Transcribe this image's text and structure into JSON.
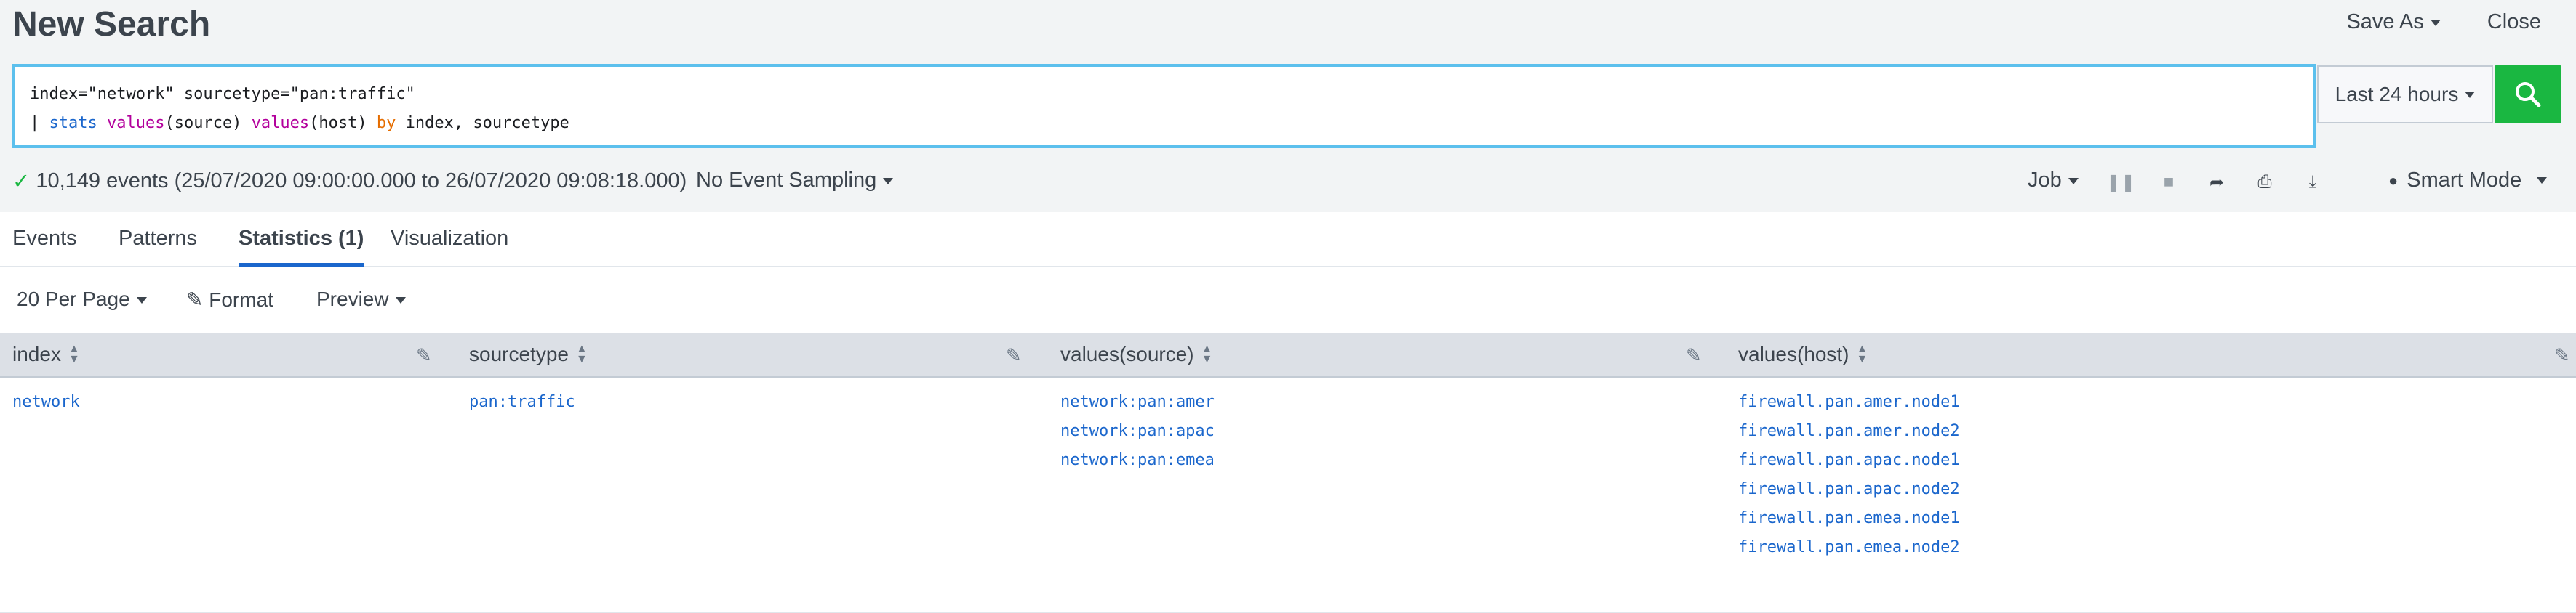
{
  "header": {
    "title": "New Search",
    "save_as": "Save As",
    "close": "Close"
  },
  "search": {
    "line1": "index=\"network\" sourcetype=\"pan:traffic\"",
    "line2": {
      "pipe": "| ",
      "cmd": "stats",
      "fn1": "values",
      "arg1": "(source) ",
      "fn2": "values",
      "arg2": "(host) ",
      "kw": "by",
      "rest": " index, sourcetype"
    },
    "time_range": "Last 24 hours"
  },
  "status": {
    "events": "10,149 events (25/07/2020 09:00:00.000 to 26/07/2020 09:08:18.000)",
    "sampling": "No Event Sampling",
    "job": "Job",
    "mode": "Smart Mode"
  },
  "tabs": [
    {
      "label": "Events"
    },
    {
      "label": "Patterns"
    },
    {
      "label": "Statistics (1)"
    },
    {
      "label": "Visualization"
    }
  ],
  "toolbar": {
    "per_page": "20 Per Page",
    "format": "Format",
    "preview": "Preview"
  },
  "table": {
    "columns": [
      "index",
      "sourcetype",
      "values(source)",
      "values(host)"
    ],
    "rows": [
      {
        "index": "network",
        "sourcetype": "pan:traffic",
        "sources": [
          "network:pan:amer",
          "network:pan:apac",
          "network:pan:emea"
        ],
        "hosts": [
          "firewall.pan.amer.node1",
          "firewall.pan.amer.node2",
          "firewall.pan.apac.node1",
          "firewall.pan.apac.node2",
          "firewall.pan.emea.node1",
          "firewall.pan.emea.node2"
        ]
      }
    ]
  },
  "colors": {
    "accent": "#1a66cc",
    "search_button": "#1ab741",
    "search_border": "#5cc0ed"
  }
}
